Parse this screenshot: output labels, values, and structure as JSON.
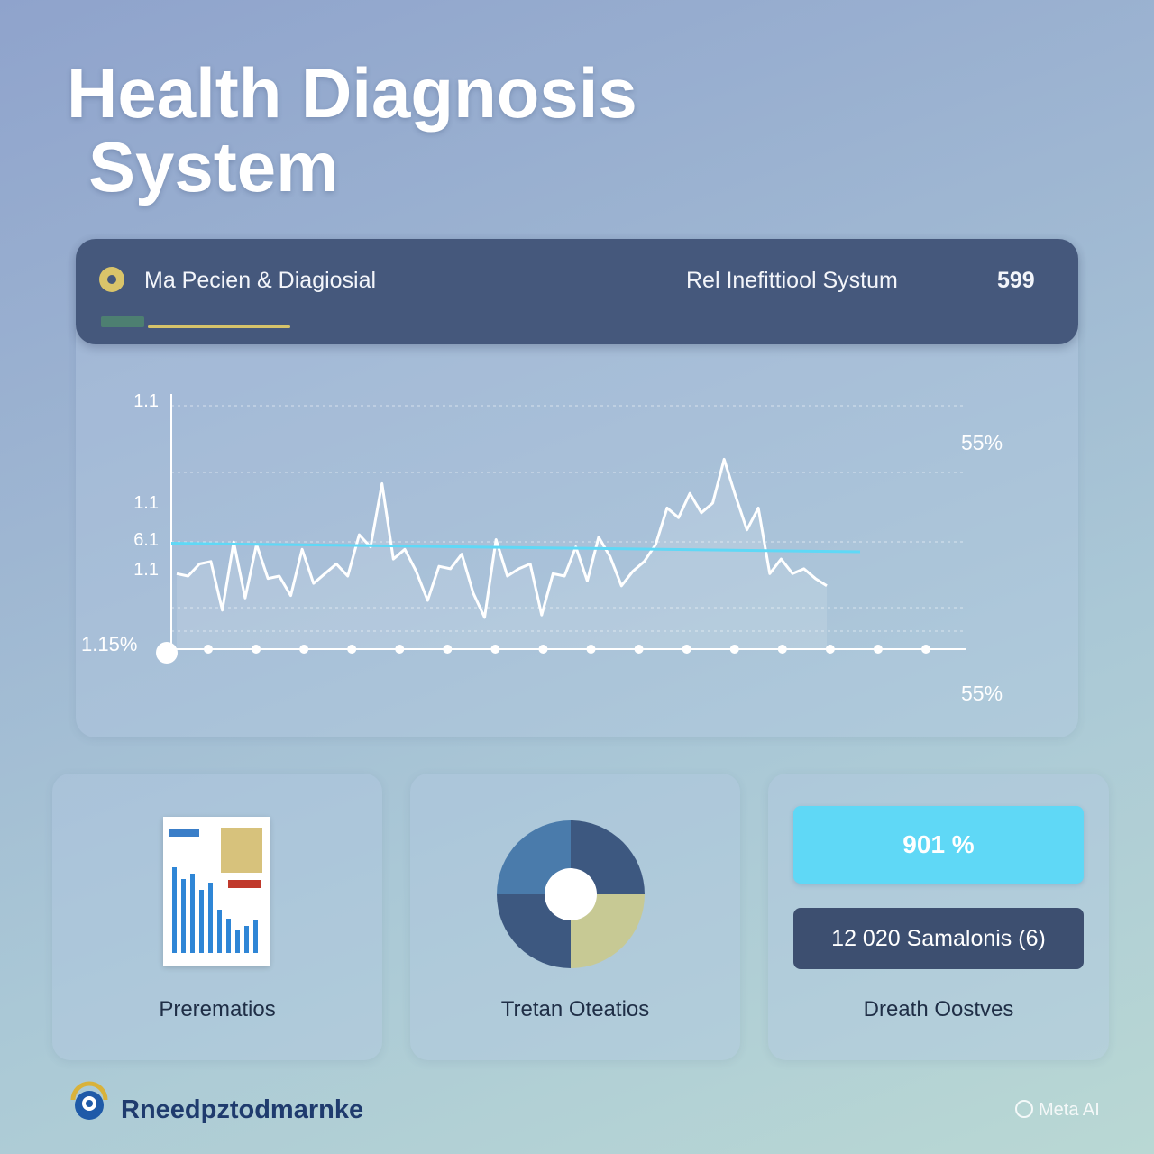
{
  "title": {
    "line1": "Health Diagnosis",
    "line2": "System"
  },
  "header": {
    "left_label": "Ma Pecien & Diagiosial",
    "right_label": "Rel Inefittiool Systum",
    "count": "599"
  },
  "chart_data": {
    "type": "line",
    "y_tick_labels": [
      "1.1",
      "1.1",
      "6.1",
      "1.1"
    ],
    "left_label": "1.15%",
    "right_labels": [
      "55%",
      "55%"
    ],
    "series": [
      {
        "values": [
          3.1,
          3.0,
          3.5,
          3.6,
          1.6,
          4.4,
          2.1,
          4.3,
          2.9,
          3.0,
          2.2,
          4.1,
          2.7,
          3.1,
          3.5,
          3.0,
          4.7,
          4.2,
          6.8,
          3.7,
          4.1,
          3.2,
          2.0,
          3.4,
          3.3,
          3.9,
          2.3,
          1.3,
          4.5,
          3.0,
          3.3,
          3.5,
          1.4,
          3.1,
          3.0,
          4.2,
          2.8,
          4.6,
          3.8,
          2.6,
          3.2,
          3.6,
          4.3,
          5.8,
          5.4,
          6.4,
          5.6,
          6.0,
          7.8,
          6.3,
          4.9,
          5.8,
          3.1,
          3.7,
          3.1,
          3.3,
          2.9,
          2.6
        ]
      }
    ],
    "trend_line": {
      "start": 4.35,
      "end": 4.0
    },
    "x_marker_count": 16,
    "ylim": [
      0,
      10
    ],
    "grid": true,
    "colors": {
      "line": "#ffffff",
      "trend": "#5fd8f6",
      "axis": "#ffffff"
    }
  },
  "cards": [
    {
      "label": "Prerematios"
    },
    {
      "label": "Tretan Oteatios"
    },
    {
      "label": "Dreath Oostves"
    }
  ],
  "stats": {
    "primary_value": "901 %",
    "secondary_value": "12 020 Samalonis (6)"
  },
  "donut": {
    "colors": [
      "#4a7bab",
      "#3d5880",
      "#c7c994",
      "#3d5880"
    ]
  },
  "footer": {
    "brand": "Rneedpztodmarnke",
    "watermark": "Meta AI"
  }
}
